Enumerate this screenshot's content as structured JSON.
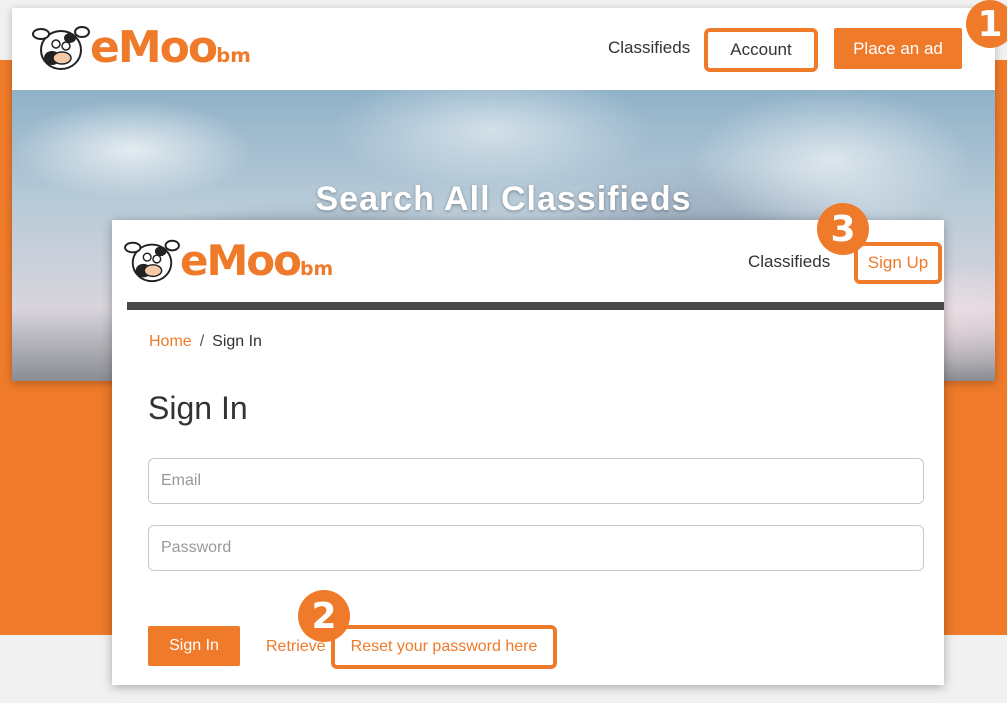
{
  "background_page": {
    "logo_text": "eMoo",
    "logo_suffix": "bm",
    "nav": {
      "classifieds": "Classifieds",
      "account": "Account",
      "place_ad": "Place an ad"
    },
    "hero_title": "Search All Classifieds"
  },
  "signin_page": {
    "logo_text": "eMoo",
    "logo_suffix": "bm",
    "nav": {
      "classifieds": "Classifieds",
      "sign_up": "Sign Up"
    },
    "breadcrumb": {
      "home": "Home",
      "separator": "/",
      "current": "Sign In"
    },
    "title": "Sign In",
    "email_placeholder": "Email",
    "password_placeholder": "Password",
    "signin_button": "Sign In",
    "retrieve_text": "Retrieve",
    "reset_link": "Reset your password here"
  },
  "callouts": [
    "1",
    "2",
    "3"
  ],
  "colors": {
    "accent": "#ee7a2a",
    "text": "#333333",
    "bar": "#4a4a4a"
  }
}
